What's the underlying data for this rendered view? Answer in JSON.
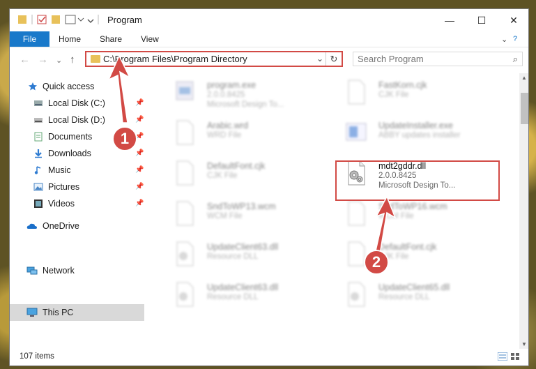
{
  "window": {
    "title": "Program",
    "controls": {
      "minimize": "—",
      "maximize": "☐",
      "close": "✕"
    }
  },
  "ribbon": {
    "file_tab": "File",
    "tabs": [
      "Home",
      "Share",
      "View"
    ]
  },
  "navigation": {
    "address_path": "C:\\Program Files\\Program Directory",
    "search_placeholder": "Search Program"
  },
  "sidebar": {
    "items": [
      {
        "label": "Quick access",
        "icon": "star-icon"
      },
      {
        "label": "Local Disk (C:)",
        "icon": "drive-icon",
        "pinned": true
      },
      {
        "label": "Local Disk (D:)",
        "icon": "drive-icon",
        "pinned": true
      },
      {
        "label": "Documents",
        "icon": "documents-icon",
        "pinned": true
      },
      {
        "label": "Downloads",
        "icon": "download-icon",
        "pinned": true
      },
      {
        "label": "Music",
        "icon": "music-icon",
        "pinned": true
      },
      {
        "label": "Pictures",
        "icon": "pictures-icon",
        "pinned": true
      },
      {
        "label": "Videos",
        "icon": "videos-icon",
        "pinned": true
      },
      {
        "label": "OneDrive",
        "icon": "cloud-icon"
      },
      {
        "label": "This PC",
        "icon": "computer-icon",
        "selected": true
      },
      {
        "label": "Network",
        "icon": "network-icon"
      }
    ]
  },
  "files": [
    {
      "name": "program.exe",
      "line1": "2.0.0.8425",
      "line2": "Microsoft Design To...",
      "blurred": true
    },
    {
      "name": "FastKorn.cjk",
      "line1": "CJK File",
      "line2": "",
      "blurred": true
    },
    {
      "name": "Arabic.wrd",
      "line1": "WRD File",
      "line2": "",
      "blurred": true
    },
    {
      "name": "UpdateInstaller.exe",
      "line1": "ABBY updates installer",
      "line2": "",
      "blurred": true
    },
    {
      "name": "DefaultFont.cjk",
      "line1": "CJK File",
      "line2": "",
      "blurred": true
    },
    {
      "name": "mdt2gddr.dll",
      "line1": "2.0.0.8425",
      "line2": "Microsoft Design To...",
      "blurred": false
    },
    {
      "name": "SndToWP13.wcm",
      "line1": "WCM File",
      "line2": "",
      "blurred": true
    },
    {
      "name": "SndToWP16.wcm",
      "line1": "WCM File",
      "line2": "",
      "blurred": true
    },
    {
      "name": "UpdateClient63.dll",
      "line1": "Resource DLL",
      "line2": "",
      "blurred": true
    },
    {
      "name": "DefaultFont.cjk",
      "line1": "CJK File",
      "line2": "",
      "blurred": true
    },
    {
      "name": "UpdateClient63.dll",
      "line1": "Resource DLL",
      "line2": "",
      "blurred": true
    },
    {
      "name": "UpdateClient65.dll",
      "line1": "Resource DLL",
      "line2": "",
      "blurred": true
    }
  ],
  "status": {
    "item_count": "107 items"
  },
  "callouts": [
    "1",
    "2"
  ]
}
